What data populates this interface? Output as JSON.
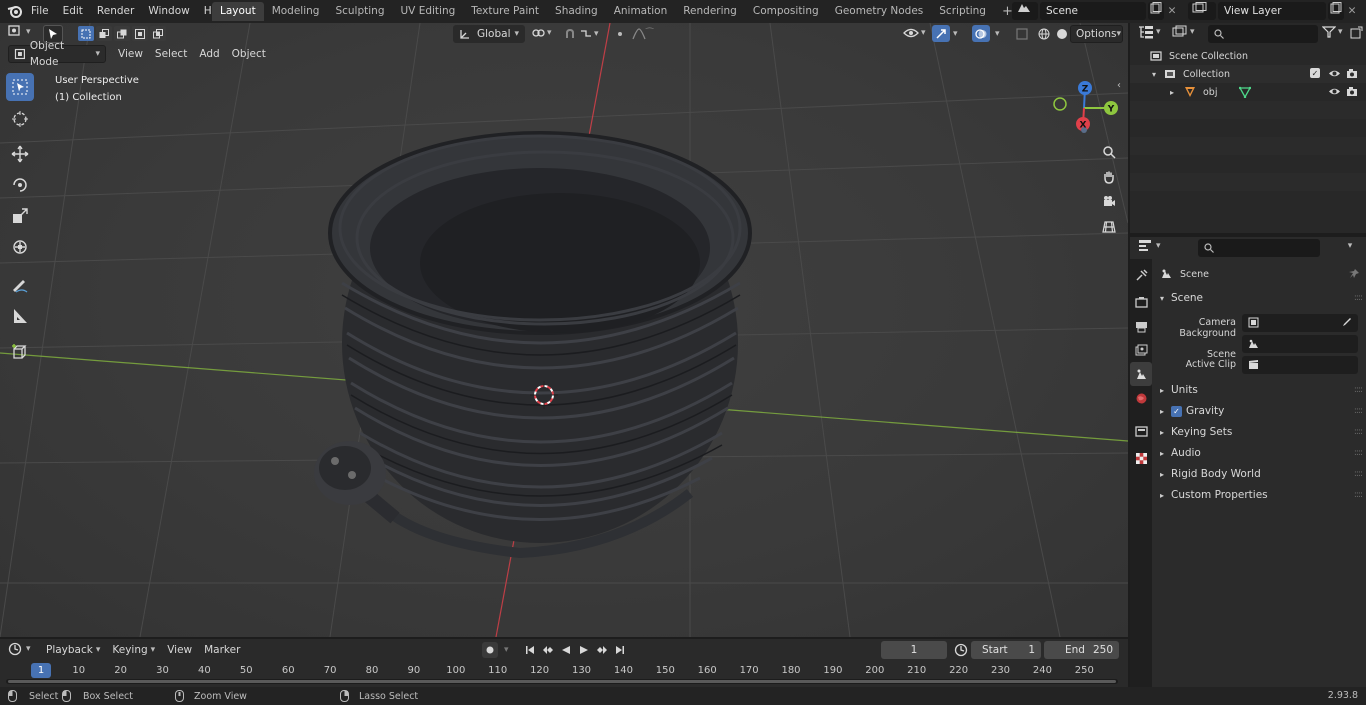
{
  "menu": [
    "File",
    "Edit",
    "Render",
    "Window",
    "Help"
  ],
  "workspaces": [
    "Layout",
    "Modeling",
    "Sculpting",
    "UV Editing",
    "Texture Paint",
    "Shading",
    "Animation",
    "Rendering",
    "Compositing",
    "Geometry Nodes",
    "Scripting"
  ],
  "active_workspace": "Layout",
  "scene_name": "Scene",
  "view_layer": "View Layer",
  "viewport": {
    "mode": "Object Mode",
    "menus": [
      "View",
      "Select",
      "Add",
      "Object"
    ],
    "transform_orientation": "Global",
    "options": "Options",
    "info_line1": "User Perspective",
    "info_line2": "(1) Collection",
    "gizmo_z": "Z",
    "gizmo_y": "Y",
    "gizmo_x": "X"
  },
  "outliner": {
    "root": "Scene Collection",
    "collection": "Collection",
    "object": "obj"
  },
  "properties": {
    "context": "Scene",
    "panel": "Scene",
    "fields": [
      {
        "label": "Camera"
      },
      {
        "label": "Background Scene"
      },
      {
        "label": "Active Clip"
      }
    ],
    "subpanels": [
      "Units",
      "Gravity",
      "Keying Sets",
      "Audio",
      "Rigid Body World",
      "Custom Properties"
    ]
  },
  "timeline": {
    "menus": [
      "Playback",
      "Keying",
      "View",
      "Marker"
    ],
    "current_frame": "1",
    "start_label": "Start",
    "start": "1",
    "end_label": "End",
    "end": "250",
    "ruler": [
      "1",
      "10",
      "20",
      "30",
      "40",
      "50",
      "60",
      "70",
      "80",
      "90",
      "100",
      "110",
      "120",
      "130",
      "140",
      "150",
      "160",
      "170",
      "180",
      "190",
      "200",
      "210",
      "220",
      "230",
      "240",
      "250"
    ]
  },
  "status": {
    "select": "Select",
    "box_select": "Box Select",
    "zoom_view": "Zoom View",
    "lasso_select": "Lasso Select",
    "version": "2.93.8"
  },
  "colors": {
    "accent": "#4772b3",
    "x_axis": "#e0404a",
    "y_axis": "#8ec63f",
    "z_axis": "#3a7ad8"
  }
}
